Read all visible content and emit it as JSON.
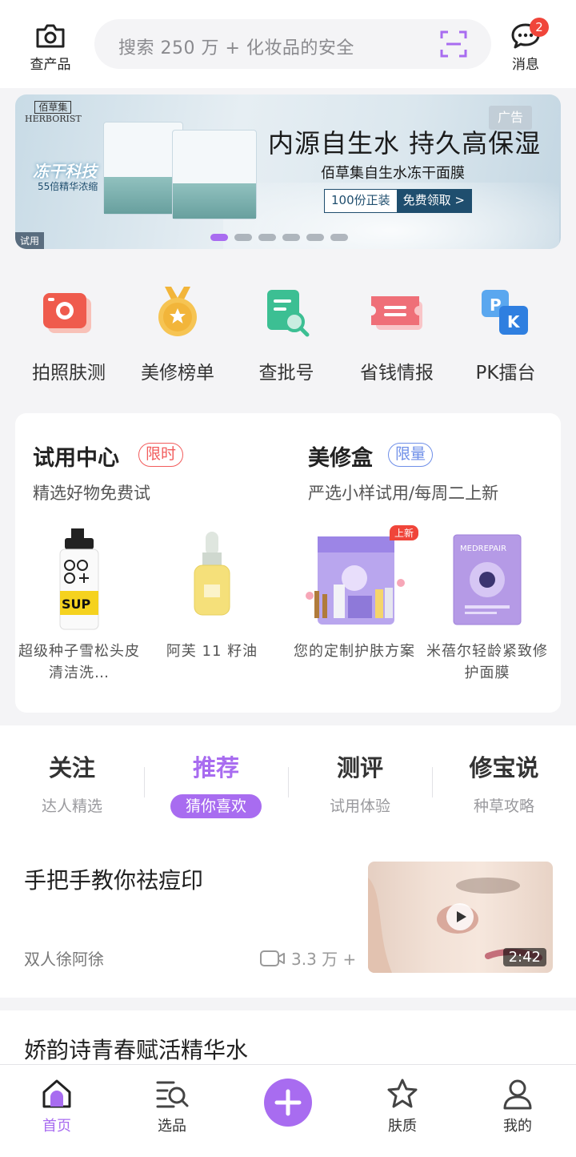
{
  "header": {
    "camera_label": "查产品",
    "search_placeholder": "搜索 250 万 + 化妆品的安全",
    "messages_label": "消息",
    "messages_badge": "2"
  },
  "banner": {
    "brand_cn": "佰草集",
    "brand_en": "HERBORIST",
    "tech_text": "冻干科技",
    "tech_sub": "55倍精华浓缩",
    "ad_tag": "广告",
    "title": "内源自生水  持久高保湿",
    "subtitle": "佰草集自生水冻干面膜",
    "cta_left": "100份正装",
    "cta_right": "免费领取 >",
    "trial_tag": "试用",
    "active_slide": 1,
    "slide_count": 6
  },
  "quick_actions": [
    {
      "label": "拍照肤测",
      "icon": "camera-skin-test-icon"
    },
    {
      "label": "美修榜单",
      "icon": "medal-icon"
    },
    {
      "label": "查批号",
      "icon": "document-search-icon"
    },
    {
      "label": "省钱情报",
      "icon": "coupon-icon"
    },
    {
      "label": "PK擂台",
      "icon": "pk-icon"
    }
  ],
  "trial_center": {
    "title": "试用中心",
    "tag": "限时",
    "subtitle": "精选好物免费试",
    "products": [
      {
        "name": "超级种子雪松头皮清洁洗…"
      },
      {
        "name": "阿芙 11 籽油"
      }
    ]
  },
  "beauty_box": {
    "title": "美修盒",
    "tag": "限量",
    "subtitle": "严选小样试用/每周二上新",
    "new_tag": "上新",
    "products": [
      {
        "name": "您的定制护肤方案"
      },
      {
        "name": "米蓓尔轻龄紧致修护面膜"
      }
    ]
  },
  "feed_tabs": [
    {
      "title": "关注",
      "sub": "达人精选"
    },
    {
      "title": "推荐",
      "sub": "猜你喜欢"
    },
    {
      "title": "测评",
      "sub": "试用体验"
    },
    {
      "title": "修宝说",
      "sub": "种草攻略"
    }
  ],
  "active_tab": 1,
  "posts": [
    {
      "title": "手把手教你祛痘印",
      "author": "双人徐阿徐",
      "views": "3.3 万 +",
      "duration": "2:42"
    },
    {
      "title": "娇韵诗青春赋活精华水"
    }
  ],
  "bottom_nav": [
    {
      "label": "首页",
      "icon": "home-icon"
    },
    {
      "label": "选品",
      "icon": "search-list-icon"
    },
    {
      "label": "",
      "icon": "plus-icon"
    },
    {
      "label": "肤质",
      "icon": "star-icon"
    },
    {
      "label": "我的",
      "icon": "user-icon"
    }
  ],
  "colors": {
    "accent": "#a86cf0",
    "badge": "#f0453a",
    "limited_red": "#f25c5c",
    "limited_blue": "#6f8fe8"
  }
}
